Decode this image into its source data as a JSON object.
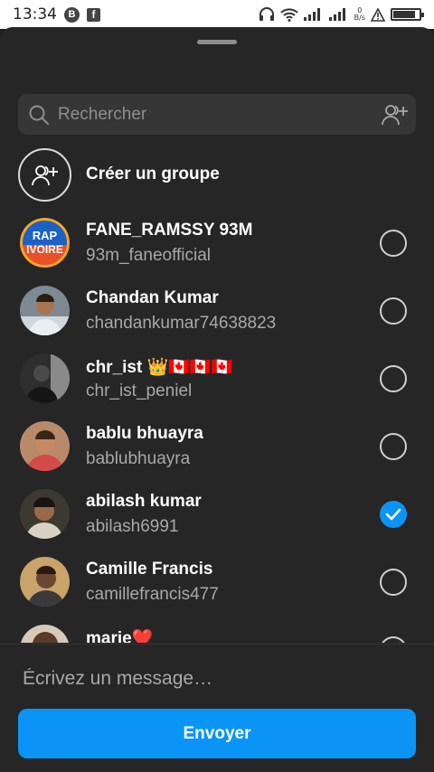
{
  "status_bar": {
    "time": "13:34",
    "icons": [
      "b-notification-icon",
      "facebook-icon",
      "headphones-icon",
      "wifi-icon",
      "signal-icon",
      "signal-icon",
      "alert-icon",
      "battery-icon"
    ],
    "net_speed_value": "0",
    "net_speed_unit": "B/s",
    "battery_level": 0.85
  },
  "search": {
    "placeholder": "Rechercher"
  },
  "create_group": {
    "label": "Créer un groupe"
  },
  "contacts": [
    {
      "name": "FANE_RAMSSY 93M",
      "username": "93m_faneofficial",
      "avatar_text": "RAP IVOIRE",
      "selected": false
    },
    {
      "name": "Chandan Kumar",
      "username": "chandankumar74638823",
      "selected": false
    },
    {
      "name": "chr_ist 👑🇨🇦🇨🇦🇨🇦",
      "username": "chr_ist_peniel",
      "selected": false
    },
    {
      "name": "bablu bhuayra",
      "username": "bablubhuayra",
      "selected": false
    },
    {
      "name": "abilash kumar",
      "username": "abilash6991",
      "selected": true
    },
    {
      "name": "Camille Francis",
      "username": "camillefrancis477",
      "selected": false
    },
    {
      "name": "marie❤️",
      "username": "",
      "selected": false
    }
  ],
  "footer": {
    "message_placeholder": "Écrivez un message…",
    "send_label": "Envoyer"
  },
  "colors": {
    "background": "#262626",
    "accent": "#0a95f6",
    "secondary_text": "#a8a8a8"
  }
}
